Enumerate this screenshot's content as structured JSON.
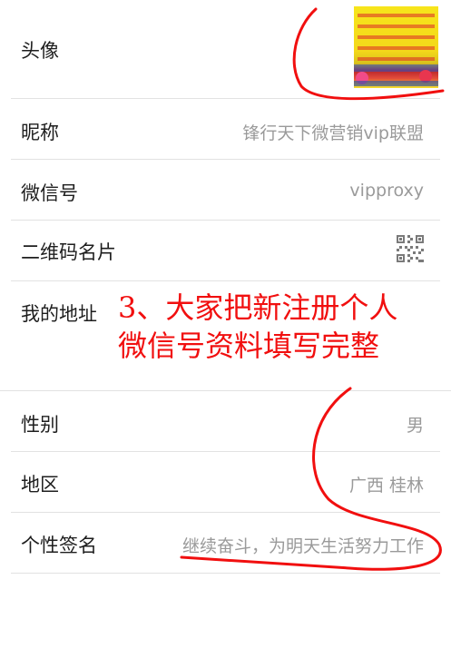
{
  "profile": {
    "rows": [
      {
        "label": "头像",
        "value": ""
      },
      {
        "label": "昵称",
        "value": "锋行天下微营销vip联盟"
      },
      {
        "label": "微信号",
        "value": "vipproxy"
      },
      {
        "label": "二维码名片",
        "value": ""
      },
      {
        "label": "我的地址",
        "value": ""
      },
      {
        "label": "性别",
        "value": "男"
      },
      {
        "label": "地区",
        "value": "广西 桂林"
      },
      {
        "label": "个性签名",
        "value": "继续奋斗，为明天生活努力工作"
      }
    ]
  },
  "annotation": {
    "line1": "3、大家把新注册个人",
    "line2": "微信号资料填写完整",
    "color": "#f10f0f"
  },
  "icons": {
    "qr": "qr-code-icon",
    "avatar": "avatar-image"
  }
}
